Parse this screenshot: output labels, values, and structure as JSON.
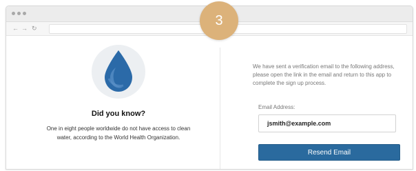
{
  "step": {
    "number": "3"
  },
  "browser": {
    "back_icon": "arrow-left-icon",
    "forward_icon": "arrow-right-icon",
    "reload_icon": "reload-icon"
  },
  "info": {
    "icon": "water-drop-icon",
    "heading": "Did you know?",
    "fact": "One in eight people worldwide do not have access to clean water, according to the World Health Organization."
  },
  "verification": {
    "message": "We have sent a verification email to the following address, please open the link in the email and return to this app to complete the sign up process.",
    "email_label": "Email Address:",
    "email_value": "jsmith@example.com",
    "resend_label": "Resend Email"
  },
  "colors": {
    "badge": "#dcb27a",
    "button": "#2a6a9e",
    "drop": "#2b6aa8"
  }
}
